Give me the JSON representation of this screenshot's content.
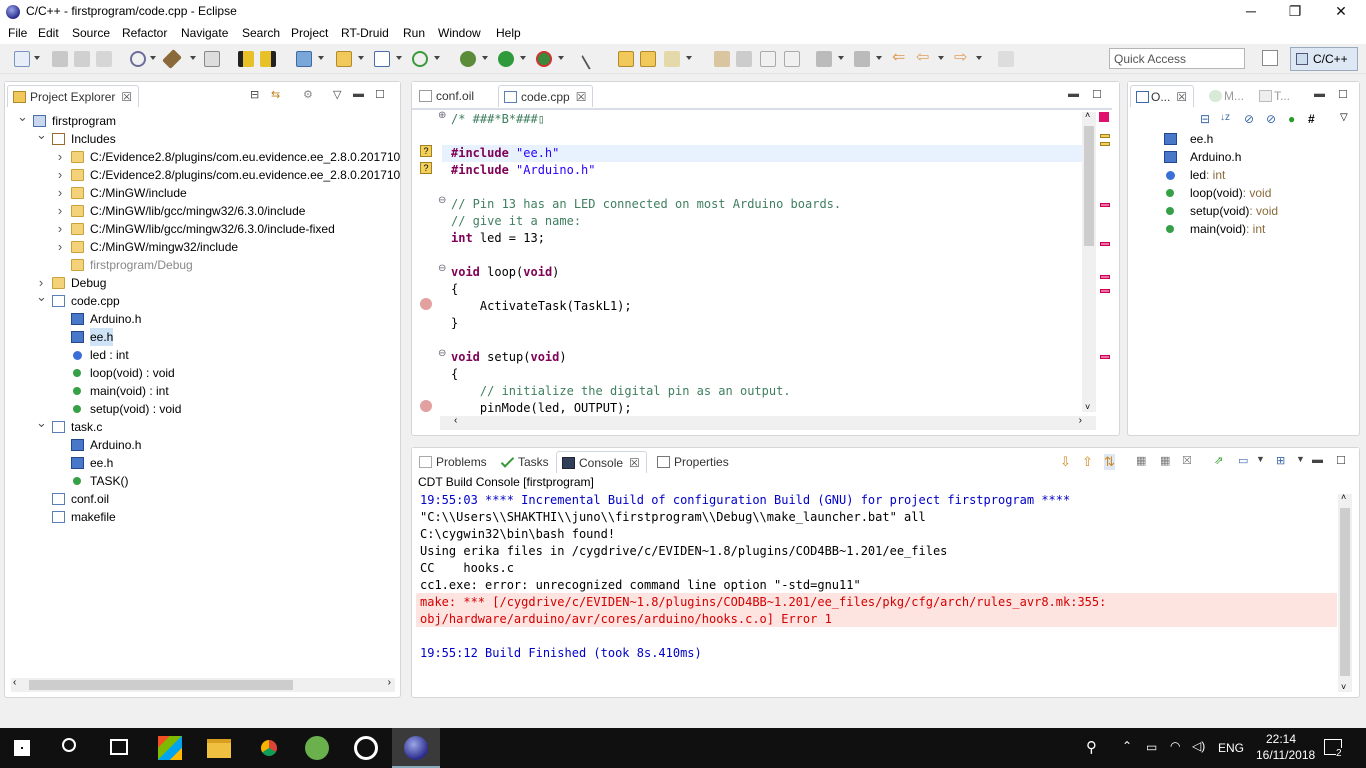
{
  "window": {
    "title": "C/C++ - firstprogram/code.cpp - Eclipse",
    "min": "─",
    "max": "❐",
    "close": "✕"
  },
  "menu": [
    "File",
    "Edit",
    "Source",
    "Refactor",
    "Navigate",
    "Search",
    "Project",
    "RT-Druid",
    "Run",
    "Window",
    "Help"
  ],
  "toolbar": {
    "quick_access_placeholder": "Quick Access",
    "perspective": "C/C++"
  },
  "project_explorer": {
    "tab": "Project Explorer",
    "tree": [
      {
        "label": "firstprogram",
        "level": 0,
        "twist": "v",
        "icon": "project-icon"
      },
      {
        "label": "Includes",
        "level": 1,
        "twist": "v",
        "icon": "includes-icon"
      },
      {
        "label": "C:/Evidence2.8/plugins/com.eu.evidence.ee_2.8.0.201710",
        "level": 2,
        "twist": ">",
        "icon": "library-folder-icon"
      },
      {
        "label": "C:/Evidence2.8/plugins/com.eu.evidence.ee_2.8.0.201710",
        "level": 2,
        "twist": ">",
        "icon": "library-folder-icon"
      },
      {
        "label": "C:/MinGW/include",
        "level": 2,
        "twist": ">",
        "icon": "library-folder-icon"
      },
      {
        "label": "C:/MinGW/lib/gcc/mingw32/6.3.0/include",
        "level": 2,
        "twist": ">",
        "icon": "library-folder-icon"
      },
      {
        "label": "C:/MinGW/lib/gcc/mingw32/6.3.0/include-fixed",
        "level": 2,
        "twist": ">",
        "icon": "library-folder-icon"
      },
      {
        "label": "C:/MinGW/mingw32/include",
        "level": 2,
        "twist": ">",
        "icon": "library-folder-icon"
      },
      {
        "label": "firstprogram/Debug",
        "level": 2,
        "twist": "",
        "icon": "folder-icon",
        "gray": true
      },
      {
        "label": "Debug",
        "level": 1,
        "twist": ">",
        "icon": "folder-icon"
      },
      {
        "label": "code.cpp",
        "level": 1,
        "twist": "v",
        "icon": "cpp-file-icon"
      },
      {
        "label": "Arduino.h",
        "level": 2,
        "twist": "",
        "icon": "header-include-icon"
      },
      {
        "label": "ee.h",
        "level": 2,
        "twist": "",
        "icon": "header-include-icon",
        "selected": true
      },
      {
        "label": "led : int",
        "level": 2,
        "twist": "",
        "icon": "variable-icon"
      },
      {
        "label": "loop(void) : void",
        "level": 2,
        "twist": "",
        "icon": "function-icon"
      },
      {
        "label": "main(void) : int",
        "level": 2,
        "twist": "",
        "icon": "function-icon"
      },
      {
        "label": "setup(void) : void",
        "level": 2,
        "twist": "",
        "icon": "function-icon"
      },
      {
        "label": "task.c",
        "level": 1,
        "twist": "v",
        "icon": "c-file-icon"
      },
      {
        "label": "Arduino.h",
        "level": 2,
        "twist": "",
        "icon": "header-include-icon"
      },
      {
        "label": "ee.h",
        "level": 2,
        "twist": "",
        "icon": "header-include-icon"
      },
      {
        "label": "TASK()",
        "level": 2,
        "twist": "",
        "icon": "function-icon"
      },
      {
        "label": "conf.oil",
        "level": 1,
        "twist": "",
        "icon": "file-icon"
      },
      {
        "label": "makefile",
        "level": 1,
        "twist": "",
        "icon": "makefile-icon"
      }
    ]
  },
  "editor": {
    "tabs": [
      "conf.oil",
      "code.cpp"
    ],
    "lines": [
      {
        "html": "/* ###*B*###▯",
        "cls": "cm",
        "fold": "⊕"
      },
      {
        "html": "",
        "cls": ""
      },
      {
        "html": "#include \"ee.h\"",
        "cls": "inc",
        "hl": true
      },
      {
        "html": "#include \"Arduino.h\"",
        "cls": "inc"
      },
      {
        "html": "",
        "cls": ""
      },
      {
        "html": "// Pin 13 has an LED connected on most Arduino boards.",
        "cls": "cm",
        "fold": "⊖"
      },
      {
        "html": "// give it a name:",
        "cls": "cm"
      },
      {
        "html": "int led = 13;",
        "cls": "int"
      },
      {
        "html": "",
        "cls": ""
      },
      {
        "html": "void loop(void)",
        "cls": "fn",
        "fold": "⊖"
      },
      {
        "html": "{",
        "cls": ""
      },
      {
        "html": "    ActivateTask(TaskL1);",
        "cls": "call"
      },
      {
        "html": "}",
        "cls": ""
      },
      {
        "html": "",
        "cls": ""
      },
      {
        "html": "void setup(void)",
        "cls": "fn",
        "fold": "⊖"
      },
      {
        "html": "{",
        "cls": ""
      },
      {
        "html": "    // initialize the digital pin as an output.",
        "cls": "cm"
      },
      {
        "html": "    pinMode(led, OUTPUT);",
        "cls": "call"
      }
    ]
  },
  "outline": {
    "tabs": [
      "O...",
      "M...",
      "T..."
    ],
    "items": [
      {
        "label": "ee.h",
        "type": "",
        "icon": "header-include-icon"
      },
      {
        "label": "Arduino.h",
        "type": "",
        "icon": "header-include-icon"
      },
      {
        "label": "led",
        "type": " : int",
        "icon": "variable-icon"
      },
      {
        "label": "loop(void)",
        "type": " : void",
        "icon": "function-icon"
      },
      {
        "label": "setup(void)",
        "type": " : void",
        "icon": "function-icon"
      },
      {
        "label": "main(void)",
        "type": " : int",
        "icon": "function-icon"
      }
    ]
  },
  "console": {
    "tabs": [
      "Problems",
      "Tasks",
      "Console",
      "Properties"
    ],
    "header": "CDT Build Console [firstprogram]",
    "lines": [
      {
        "text": "19:55:03 **** Incremental Build of configuration Build (GNU) for project firstprogram ****",
        "cls": "blue"
      },
      {
        "text": "\"C:\\\\Users\\\\SHAKTHI\\\\juno\\\\firstprogram\\\\Debug\\\\make_launcher.bat\" all",
        "cls": ""
      },
      {
        "text": "C:\\cygwin32\\bin\\bash found!",
        "cls": ""
      },
      {
        "text": "Using erika files in /cygdrive/c/EVIDEN~1.8/plugins/COD4BB~1.201/ee_files",
        "cls": ""
      },
      {
        "text": "CC    hooks.c",
        "cls": ""
      },
      {
        "text": "cc1.exe: error: unrecognized command line option \"-std=gnu11\"",
        "cls": ""
      },
      {
        "text": "make: *** [/cygdrive/c/EVIDEN~1.8/plugins/COD4BB~1.201/ee_files/pkg/cfg/arch/rules_avr8.mk:355:",
        "cls": "red"
      },
      {
        "text": "obj/hardware/arduino/avr/cores/arduino/hooks.c.o] Error 1",
        "cls": "red"
      },
      {
        "text": "",
        "cls": ""
      },
      {
        "text": "19:55:12 Build Finished (took 8s.410ms)",
        "cls": "blue"
      }
    ]
  },
  "taskbar": {
    "lang": "ENG",
    "time": "22:14",
    "date": "16/11/2018",
    "notif": "2"
  }
}
